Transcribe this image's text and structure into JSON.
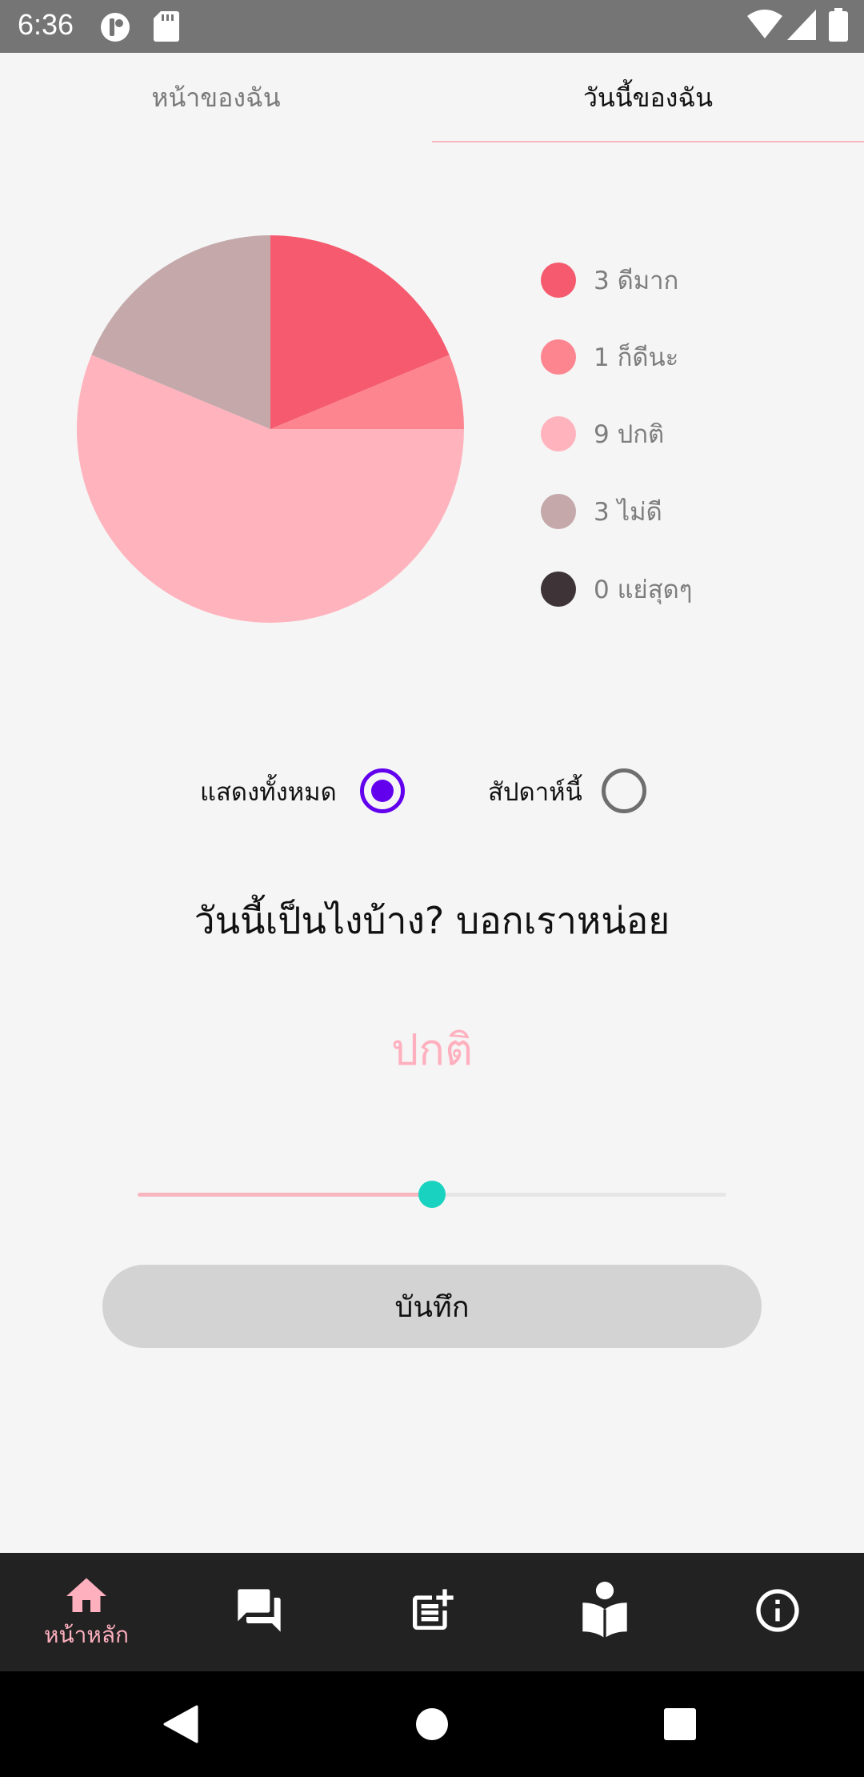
{
  "status_bar": {
    "time": "6:36",
    "icons": [
      "notification-app-icon",
      "sd-card-icon",
      "wifi-icon",
      "signal-icon",
      "battery-icon"
    ]
  },
  "tabs": [
    {
      "label": "หน้าของฉัน",
      "selected": false
    },
    {
      "label": "วันนี้ของฉัน",
      "selected": true
    }
  ],
  "colors": {
    "accent": "#ffb0bf",
    "tab_indicator": "#f7b6c0",
    "radio_checked": "#6200ee",
    "slider_thumb": "#1ad2c0",
    "save_button_bg": "#d3d3d3",
    "bottom_nav_bg": "#222222"
  },
  "chart_data": {
    "type": "pie",
    "slices": [
      {
        "label": "ดีมาก",
        "value": 3,
        "color": "#f55a6e"
      },
      {
        "label": "ก็ดีนะ",
        "value": 1,
        "color": "#fd8590"
      },
      {
        "label": "ปกติ",
        "value": 9,
        "color": "#ffb3bd"
      },
      {
        "label": "ไม่ดี",
        "value": 3,
        "color": "#c4a8aa"
      },
      {
        "label": "แย่สุดๆ",
        "value": 0,
        "color": "#3e3438"
      }
    ],
    "legend_position": "right"
  },
  "legend": [
    {
      "text": "3 ดีมาก"
    },
    {
      "text": "1 ก็ดีนะ"
    },
    {
      "text": "9 ปกติ"
    },
    {
      "text": "3 ไม่ดี"
    },
    {
      "text": "0 แย่สุดๆ"
    }
  ],
  "filter": {
    "options": [
      {
        "label": "แสดงทั้งหมด",
        "checked": true
      },
      {
        "label": "สัปดาห์นี้",
        "checked": false
      }
    ]
  },
  "question": "วันนี้เป็นไงบ้าง? บอกเราหน่อย",
  "mood_value": "ปกติ",
  "slider": {
    "value": 0.5
  },
  "save_button": "บันทึก",
  "bottom_nav": {
    "items": [
      {
        "icon": "home-icon",
        "label": "หน้าหลัก",
        "selected": true
      },
      {
        "icon": "forum-icon",
        "label": ""
      },
      {
        "icon": "post-add-icon",
        "label": ""
      },
      {
        "icon": "reading-icon",
        "label": ""
      },
      {
        "icon": "info-icon",
        "label": ""
      }
    ]
  },
  "system_nav": [
    "back-icon",
    "home-circle-icon",
    "recents-icon"
  ]
}
